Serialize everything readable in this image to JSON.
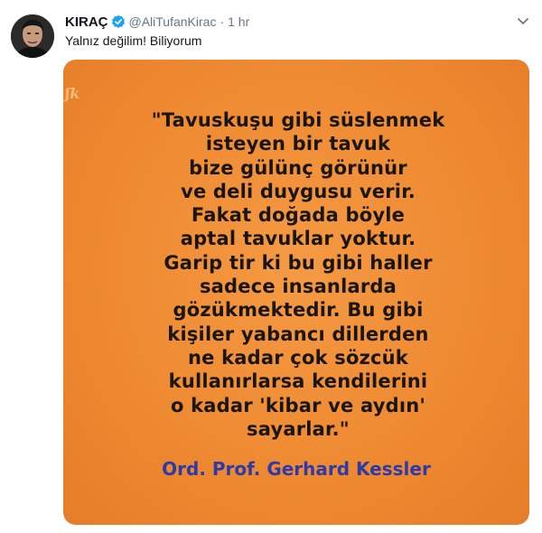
{
  "tweet": {
    "display_name": "KIRAÇ",
    "handle": "@AliTufanKirac",
    "separator": "·",
    "time": "1 hr",
    "text": "Yalnız değilim! Biliyorum",
    "icons": {
      "verified": "verified-badge-icon",
      "menu": "chevron-down-icon"
    },
    "colors": {
      "verified": "#1da1f2",
      "media_background": "#ee8a32",
      "author_text": "#2e3aa8"
    }
  },
  "image": {
    "quote_lines": [
      "\"Tavuskuşu gibi süslenmek",
      "isteyen bir tavuk",
      "bize gülünç görünür",
      "ve deli duygusu verir.",
      "Fakat doğada böyle",
      "aptal tavuklar yoktur.",
      "Garip tir ki bu gibi haller",
      "sadece insanlarda",
      "gözükmektedir. Bu gibi",
      "kişiler yabancı dillerden",
      "ne kadar çok sözcük",
      "kullanırlarsa kendilerini",
      "o kadar 'kibar ve aydın'",
      "sayarlar.\""
    ],
    "author": "Ord. Prof. Gerhard Kessler"
  }
}
